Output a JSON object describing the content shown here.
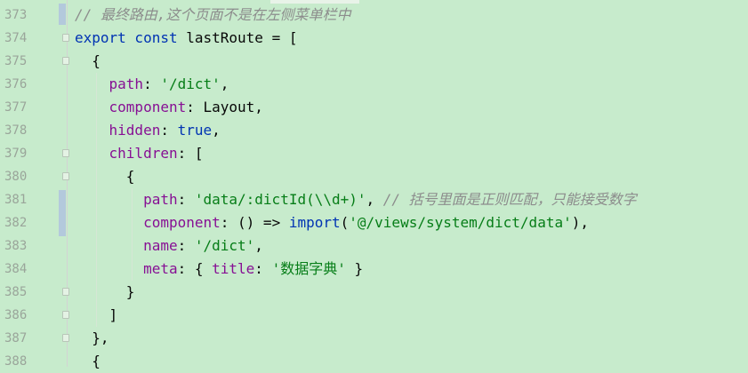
{
  "editor": {
    "background": "#c7ebcc",
    "colors": {
      "comment": "#8c8c8c",
      "keyword": "#0033b3",
      "property": "#871094",
      "string": "#067d17",
      "plain": "#080808"
    },
    "lines": [
      {
        "num": "373",
        "tokens": [
          {
            "t": "// 最终路由,这个页面不是在左侧菜单栏中",
            "c": "comment"
          }
        ]
      },
      {
        "num": "374",
        "tokens": [
          {
            "t": "export const ",
            "c": "kw"
          },
          {
            "t": "lastRoute",
            "c": "fn"
          },
          {
            "t": " = [",
            "c": "plain"
          }
        ]
      },
      {
        "num": "375",
        "tokens": [
          {
            "t": "  {",
            "c": "plain"
          }
        ]
      },
      {
        "num": "376",
        "tokens": [
          {
            "t": "    ",
            "c": "plain"
          },
          {
            "t": "path",
            "c": "prop"
          },
          {
            "t": ": ",
            "c": "plain"
          },
          {
            "t": "'/dict'",
            "c": "str"
          },
          {
            "t": ",",
            "c": "plain"
          }
        ]
      },
      {
        "num": "377",
        "tokens": [
          {
            "t": "    ",
            "c": "plain"
          },
          {
            "t": "component",
            "c": "prop"
          },
          {
            "t": ": Layout,",
            "c": "plain"
          }
        ]
      },
      {
        "num": "378",
        "tokens": [
          {
            "t": "    ",
            "c": "plain"
          },
          {
            "t": "hidden",
            "c": "prop"
          },
          {
            "t": ": ",
            "c": "plain"
          },
          {
            "t": "true",
            "c": "kw"
          },
          {
            "t": ",",
            "c": "plain"
          }
        ]
      },
      {
        "num": "379",
        "tokens": [
          {
            "t": "    ",
            "c": "plain"
          },
          {
            "t": "children",
            "c": "prop"
          },
          {
            "t": ": [",
            "c": "plain"
          }
        ]
      },
      {
        "num": "380",
        "tokens": [
          {
            "t": "      {",
            "c": "plain"
          }
        ]
      },
      {
        "num": "381",
        "tokens": [
          {
            "t": "        ",
            "c": "plain"
          },
          {
            "t": "path",
            "c": "prop"
          },
          {
            "t": ": ",
            "c": "plain"
          },
          {
            "t": "'data/:dictId(\\\\d+)'",
            "c": "str"
          },
          {
            "t": ", ",
            "c": "plain"
          },
          {
            "t": "// 括号里面是正则匹配，只能接受数字",
            "c": "comment"
          }
        ]
      },
      {
        "num": "382",
        "tokens": [
          {
            "t": "        ",
            "c": "plain"
          },
          {
            "t": "component",
            "c": "prop"
          },
          {
            "t": ": () => ",
            "c": "plain"
          },
          {
            "t": "import",
            "c": "kw"
          },
          {
            "t": "(",
            "c": "plain"
          },
          {
            "t": "'@/views/system/dict/data'",
            "c": "str"
          },
          {
            "t": "),",
            "c": "plain"
          }
        ]
      },
      {
        "num": "383",
        "tokens": [
          {
            "t": "        ",
            "c": "plain"
          },
          {
            "t": "name",
            "c": "prop"
          },
          {
            "t": ": ",
            "c": "plain"
          },
          {
            "t": "'/dict'",
            "c": "str"
          },
          {
            "t": ",",
            "c": "plain"
          }
        ]
      },
      {
        "num": "384",
        "tokens": [
          {
            "t": "        ",
            "c": "plain"
          },
          {
            "t": "meta",
            "c": "prop"
          },
          {
            "t": ": { ",
            "c": "plain"
          },
          {
            "t": "title",
            "c": "prop"
          },
          {
            "t": ": ",
            "c": "plain"
          },
          {
            "t": "'数据字典'",
            "c": "str"
          },
          {
            "t": " }",
            "c": "plain"
          }
        ]
      },
      {
        "num": "385",
        "tokens": [
          {
            "t": "      }",
            "c": "plain"
          }
        ]
      },
      {
        "num": "386",
        "tokens": [
          {
            "t": "    ]",
            "c": "plain"
          }
        ]
      },
      {
        "num": "387",
        "tokens": [
          {
            "t": "  },",
            "c": "plain"
          }
        ]
      },
      {
        "num": "388",
        "tokens": [
          {
            "t": "  {",
            "c": "plain"
          }
        ]
      }
    ]
  }
}
